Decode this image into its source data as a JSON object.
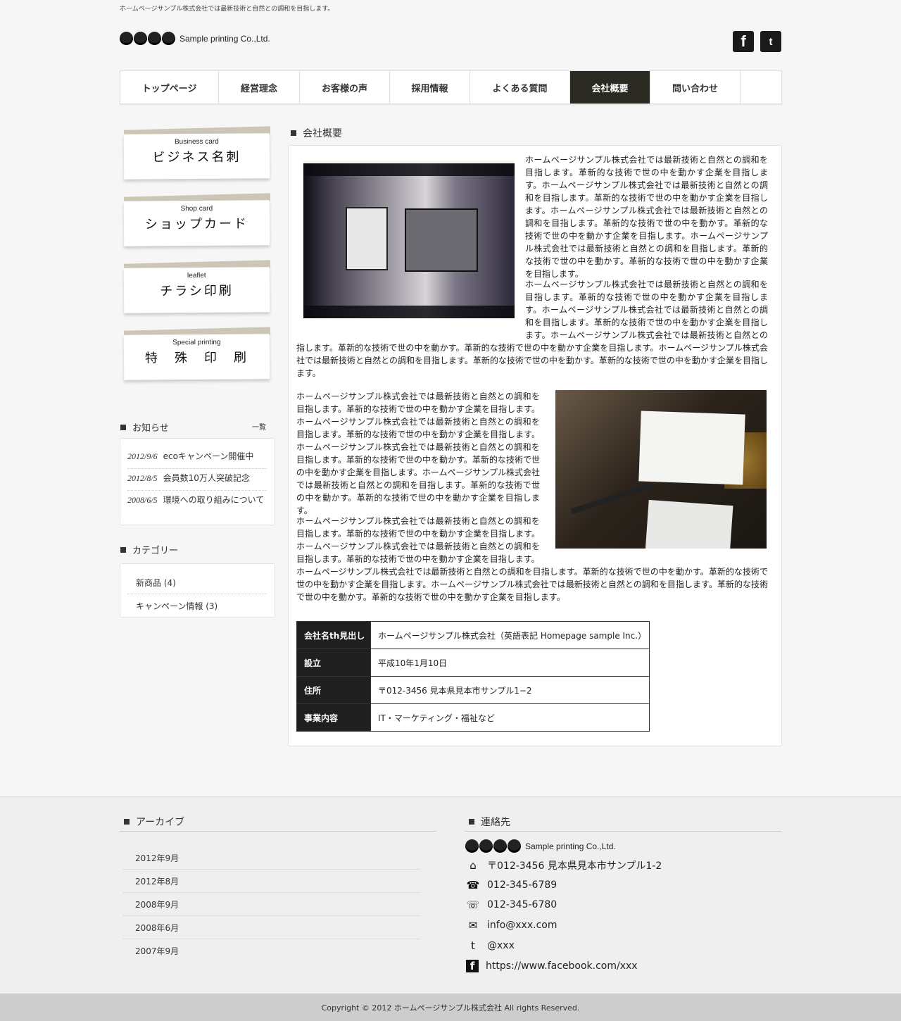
{
  "header": {
    "tagline": "ホームページサンプル株式会社では最新技術と自然との調和を目指します。",
    "logo_text": "Sample printing  Co.,Ltd.",
    "facebook_glyph": "f",
    "twitter_glyph": "t"
  },
  "nav": [
    {
      "label": "トップページ"
    },
    {
      "label": "経営理念"
    },
    {
      "label": "お客様の声"
    },
    {
      "label": "採用情報"
    },
    {
      "label": "よくある質問"
    },
    {
      "label": "会社概要",
      "active": true
    },
    {
      "label": "問い合わせ"
    }
  ],
  "banners": [
    {
      "en": "Business card",
      "jp": "ビジネス名刺"
    },
    {
      "en": "Shop card",
      "jp": "ショップカード"
    },
    {
      "en": "leaflet",
      "jp": "チラシ印刷"
    },
    {
      "en": "Special printing",
      "jp": "特　殊　印　刷"
    }
  ],
  "news": {
    "title": "お知らせ",
    "more": "一覧",
    "items": [
      {
        "date": "2012/9/6",
        "text": "ecoキャンペーン開催中"
      },
      {
        "date": "2012/8/5",
        "text": "会員数10万人突破記念"
      },
      {
        "date": "2008/6/5",
        "text": "環境への取り組みについて"
      }
    ]
  },
  "categories": {
    "title": "カテゴリー",
    "items": [
      "新商品 (4)",
      "キャンペーン情報 (3)"
    ]
  },
  "main": {
    "title": "会社概要",
    "p1": "ホームページサンプル株式会社では最新技術と自然との調和を目指します。革新的な技術で世の中を動かす企業を目指します。ホームページサンプル株式会社では最新技術と自然との調和を目指します。革新的な技術で世の中を動かす企業を目指します。ホームページサンプル株式会社では最新技術と自然との調和を目指します。革新的な技術で世の中を動かす。革新的な技術で世の中を動かす企業を目指します。ホームページサンプル株式会社では最新技術と自然との調和を目指します。革新的な技術で世の中を動かす。革新的な技術で世の中を動かす企業を目指します。",
    "p2a": "ホームページサンプル株式会社では最新技術と自然との調和を目指します。革新的な技術で世の中を動かす企業を目指します。ホームページサンプル株式会社では最新技術と自然との調和を目指します。革新的な技術で世の中を動かす企業を目指します。ホームページサンプル株式会社では最新技術と自然との調和を目",
    "p2b": "指します。革新的な技術で世の中を動かす。革新的な技術で世の中を動かす企業を目指します。ホームページサンプル株式会社では最新技術と自然との調和を目指します。革新的な技術で世の中を動かす。革新的な技術で世の中を動かす企業を目指します。",
    "p3": "ホームページサンプル株式会社では最新技術と自然との調和を目指します。革新的な技術で世の中を動かす企業を目指します。ホームページサンプル株式会社では最新技術と自然との調和を目指します。革新的な技術で世の中を動かす企業を目指します。ホームページサンプル株式会社では最新技術と自然との調和を目指します。革新的な技術で世の中を動かす。革新的な技術で世の中を動かす企業を目指します。ホームページサンプル株式会社では最新技術と自然との調和を目指します。革新的な技術で世の中を動かす。革新的な技術で世の中を動かす企業を目指します。",
    "p4a": "ホームページサンプル株式会社では最新技術と自然との調和を目指します。革新的な技術で世の中を動かす企業を目指します。ホームページサンプル株式会社では最新技術と自然との調和を目指します。革新的な技術で世の中を動かす企業を目指します。",
    "p4b": "ホームページサンプル株式会社では最新技術と自然との調和を目指します。革新的な技術で世の中を動かす。革新的な技術で世の中を動かす企業を目指します。ホームページサンプル株式会社では最新技術と自然との調和を目指します。革新的な技術で世の中を動かす。革新的な技術で世の中を動かす企業を目指します。",
    "table": [
      {
        "th": "会社名th見出し",
        "td": "ホームページサンプル株式会社（英語表記 Homepage sample Inc.）"
      },
      {
        "th": "設立",
        "td": "平成10年1月10日"
      },
      {
        "th": "住所",
        "td": "〒012-3456 見本県見本市サンプル1−2"
      },
      {
        "th": "事業内容",
        "td": "IT・マーケティング・福祉など"
      }
    ]
  },
  "footer": {
    "archive_title": "アーカイブ",
    "archives": [
      "2012年9月",
      "2012年8月",
      "2008年9月",
      "2008年6月",
      "2007年9月"
    ],
    "contact_title": "連絡先",
    "logo_text": "Sample printing  Co.,Ltd.",
    "contacts": [
      {
        "icon": "home-icon",
        "glyph": "⌂",
        "text": "〒012-3456 見本県見本市サンプル1-2"
      },
      {
        "icon": "phone-icon",
        "glyph": "☎",
        "text": "012-345-6789"
      },
      {
        "icon": "fax-icon",
        "glyph": "☏",
        "text": "012-345-6780"
      },
      {
        "icon": "mail-icon",
        "glyph": "✉",
        "text": "info@xxx.com"
      },
      {
        "icon": "twitter-icon",
        "glyph": "t",
        "text": "@xxx"
      },
      {
        "icon": "facebook-icon",
        "glyph": "f",
        "text": "https://www.facebook.com/xxx"
      }
    ],
    "copyright": "Copyright © 2012 ホームページサンプル株式会社 All rights Reserved."
  }
}
